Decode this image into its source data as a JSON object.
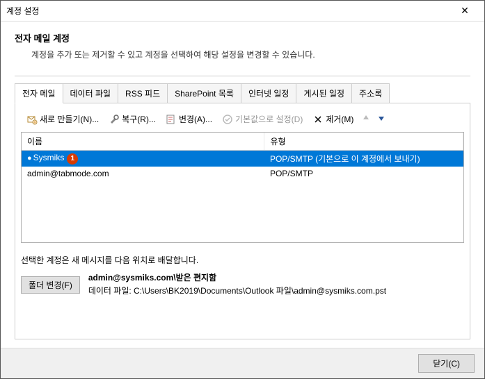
{
  "window": {
    "title": "계정 설정",
    "section_title": "전자 메일 계정",
    "section_desc": "계정을 추가 또는 제거할 수 있고 계정을 선택하여 해당 설정을 변경할 수 있습니다."
  },
  "tabs": [
    {
      "label": "전자 메일",
      "active": true
    },
    {
      "label": "데이터 파일",
      "active": false
    },
    {
      "label": "RSS 피드",
      "active": false
    },
    {
      "label": "SharePoint 목록",
      "active": false
    },
    {
      "label": "인터넷 일정",
      "active": false
    },
    {
      "label": "게시된 일정",
      "active": false
    },
    {
      "label": "주소록",
      "active": false
    }
  ],
  "toolbar": {
    "new": "새로 만들기(N)...",
    "repair": "복구(R)...",
    "change": "변경(A)...",
    "default": "기본값으로 설정(D)",
    "remove": "제거(M)"
  },
  "table": {
    "columns": {
      "name": "이름",
      "type": "유형"
    },
    "rows": [
      {
        "name": "Sysmiks",
        "type": "POP/SMTP (기본으로 이 계정에서 보내기)",
        "selected": true,
        "checked": true,
        "badge": "1"
      },
      {
        "name": "admin@tabmode.com",
        "type": "POP/SMTP",
        "selected": false,
        "checked": false
      }
    ]
  },
  "delivery": {
    "desc": "선택한 계정은 새 메시지를 다음 위치로 배달합니다.",
    "folder_btn": "폴더 변경(F)",
    "account_folder": "admin@sysmiks.com\\받은 편지함",
    "data_file": "데이터 파일: C:\\Users\\BK2019\\Documents\\Outlook 파일\\admin@sysmiks.com.pst"
  },
  "footer": {
    "close": "닫기(C)"
  }
}
